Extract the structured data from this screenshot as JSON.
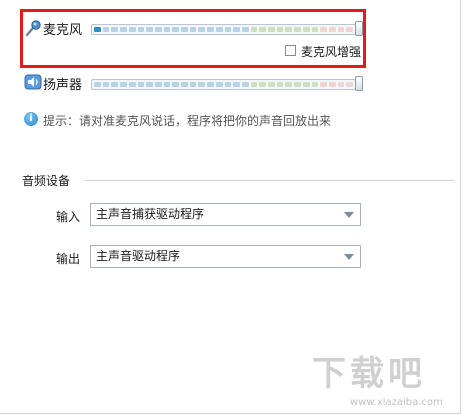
{
  "microphone": {
    "label": "麦克风",
    "icon": "microphone-icon",
    "level": 0.03,
    "enhance_label": "麦克风增强",
    "enhance_checked": false
  },
  "speaker": {
    "label": "扬声器",
    "icon": "speaker-icon",
    "level": 0.0
  },
  "hint": {
    "text": "提示：请对准麦克风说话，程序将把你的声音回放出来"
  },
  "audio_devices": {
    "title": "音频设备",
    "input": {
      "label": "输入",
      "value": "主声音捕获驱动程序"
    },
    "output": {
      "label": "输出",
      "value": "主声音驱动程序"
    }
  },
  "colors": {
    "highlight_border": "#e21b1b",
    "meter_active": "#2e8fc8",
    "meter_low": "#b8d3e6",
    "meter_mid": "#cfe0c1",
    "meter_high": "#f0d4cf"
  },
  "watermark": {
    "logo_text": "下载吧",
    "url_text": "www.xiazaiba.com"
  }
}
